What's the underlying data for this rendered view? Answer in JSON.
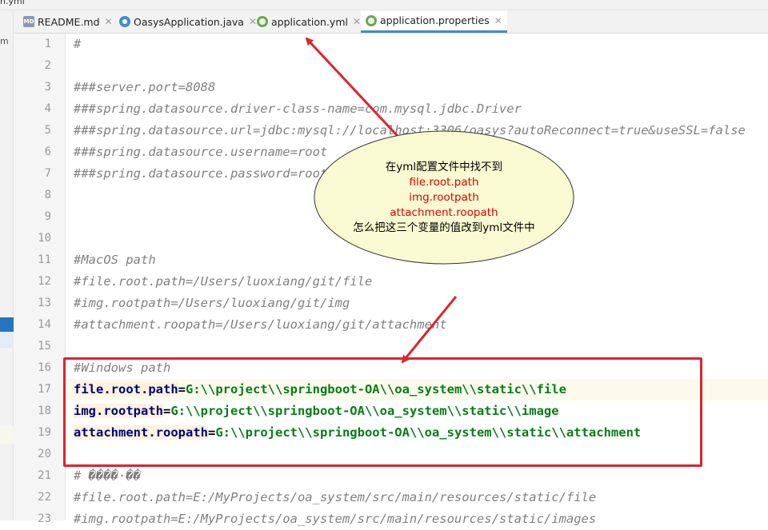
{
  "window": {
    "title_fragment": "n.yml"
  },
  "sidebar": {
    "fragment": "m"
  },
  "tabs": [
    {
      "label": "README.md",
      "icon": "markdown-file-icon",
      "active": false
    },
    {
      "label": "OasysApplication.java",
      "icon": "java-class-icon",
      "active": false
    },
    {
      "label": "application.yml",
      "icon": "spring-config-icon",
      "active": false
    },
    {
      "label": "application.properties",
      "icon": "spring-config-icon",
      "active": true
    }
  ],
  "editor": {
    "lines": [
      {
        "n": "1",
        "parts": [
          {
            "t": "#",
            "c": "comment"
          }
        ]
      },
      {
        "n": "2",
        "parts": []
      },
      {
        "n": "3",
        "parts": [
          {
            "t": "###server.port=8088",
            "c": "comment"
          }
        ]
      },
      {
        "n": "4",
        "parts": [
          {
            "t": "###spring.datasource.driver-class-name=com.mysql.jdbc.Driver",
            "c": "comment"
          }
        ]
      },
      {
        "n": "5",
        "parts": [
          {
            "t": "###spring.datasource.url=jdbc:mysql://localhost:3306/oasys?autoReconnect=true&useSSL=false",
            "c": "comment"
          }
        ]
      },
      {
        "n": "6",
        "parts": [
          {
            "t": "###spring.datasource.username=root",
            "c": "comment"
          }
        ]
      },
      {
        "n": "7",
        "parts": [
          {
            "t": "###spring.datasource.password=root",
            "c": "comment"
          }
        ]
      },
      {
        "n": "8",
        "parts": []
      },
      {
        "n": "9",
        "parts": []
      },
      {
        "n": "10",
        "parts": []
      },
      {
        "n": "11",
        "parts": [
          {
            "t": "#MacOS path",
            "c": "comment"
          }
        ]
      },
      {
        "n": "12",
        "parts": [
          {
            "t": "#file.root.path=/Users/luoxiang/git/file",
            "c": "comment"
          }
        ]
      },
      {
        "n": "13",
        "parts": [
          {
            "t": "#img.rootpath=/Users/luoxiang/git/img",
            "c": "comment"
          }
        ]
      },
      {
        "n": "14",
        "parts": [
          {
            "t": "#attachment.roopath=/Users/luoxiang/git/attachment",
            "c": "comment"
          }
        ]
      },
      {
        "n": "15",
        "parts": []
      },
      {
        "n": "16",
        "parts": [
          {
            "t": "#Windows path",
            "c": "comment"
          }
        ]
      },
      {
        "n": "17",
        "current": true,
        "parts": [
          {
            "t": "file.root.path",
            "c": "key"
          },
          {
            "t": "=",
            "c": "eq"
          },
          {
            "t": "G:\\\\project\\\\springboot-OA\\\\oa_system\\\\static\\\\file",
            "c": "val"
          }
        ]
      },
      {
        "n": "18",
        "parts": [
          {
            "t": "img.rootpath",
            "c": "key"
          },
          {
            "t": "=",
            "c": "eq"
          },
          {
            "t": "G:\\\\project\\\\springboot-OA\\\\oa_system\\\\static\\\\image",
            "c": "val"
          }
        ]
      },
      {
        "n": "19",
        "parts": [
          {
            "t": "attachment.roopath",
            "c": "key"
          },
          {
            "t": "=",
            "c": "eq"
          },
          {
            "t": "G:\\\\project\\\\springboot-OA\\\\oa_system\\\\static\\\\attachment",
            "c": "val"
          }
        ]
      },
      {
        "n": "20",
        "parts": []
      },
      {
        "n": "21",
        "parts": [
          {
            "t": "# ����·��",
            "c": "comment"
          }
        ]
      },
      {
        "n": "22",
        "parts": [
          {
            "t": "#file.root.path=E:/MyProjects/oa_system/src/main/resources/static/file",
            "c": "comment"
          }
        ]
      },
      {
        "n": "23",
        "parts": [
          {
            "t": "#img.rootpath=E:/MyProjects/oa_system/src/main/resources/static/images",
            "c": "comment"
          }
        ]
      }
    ]
  },
  "annotation": {
    "line1": "在yml配置文件中找不到",
    "var1": "file.root.path",
    "var2": "img.rootpath",
    "var3": "attachment.roopath",
    "line5": "怎么把这三个变量的值改到yml文件中",
    "colors": {
      "arrow": "#e0232b",
      "bubble_fill": "#fafad2",
      "highlight_text": "#e00000"
    }
  }
}
